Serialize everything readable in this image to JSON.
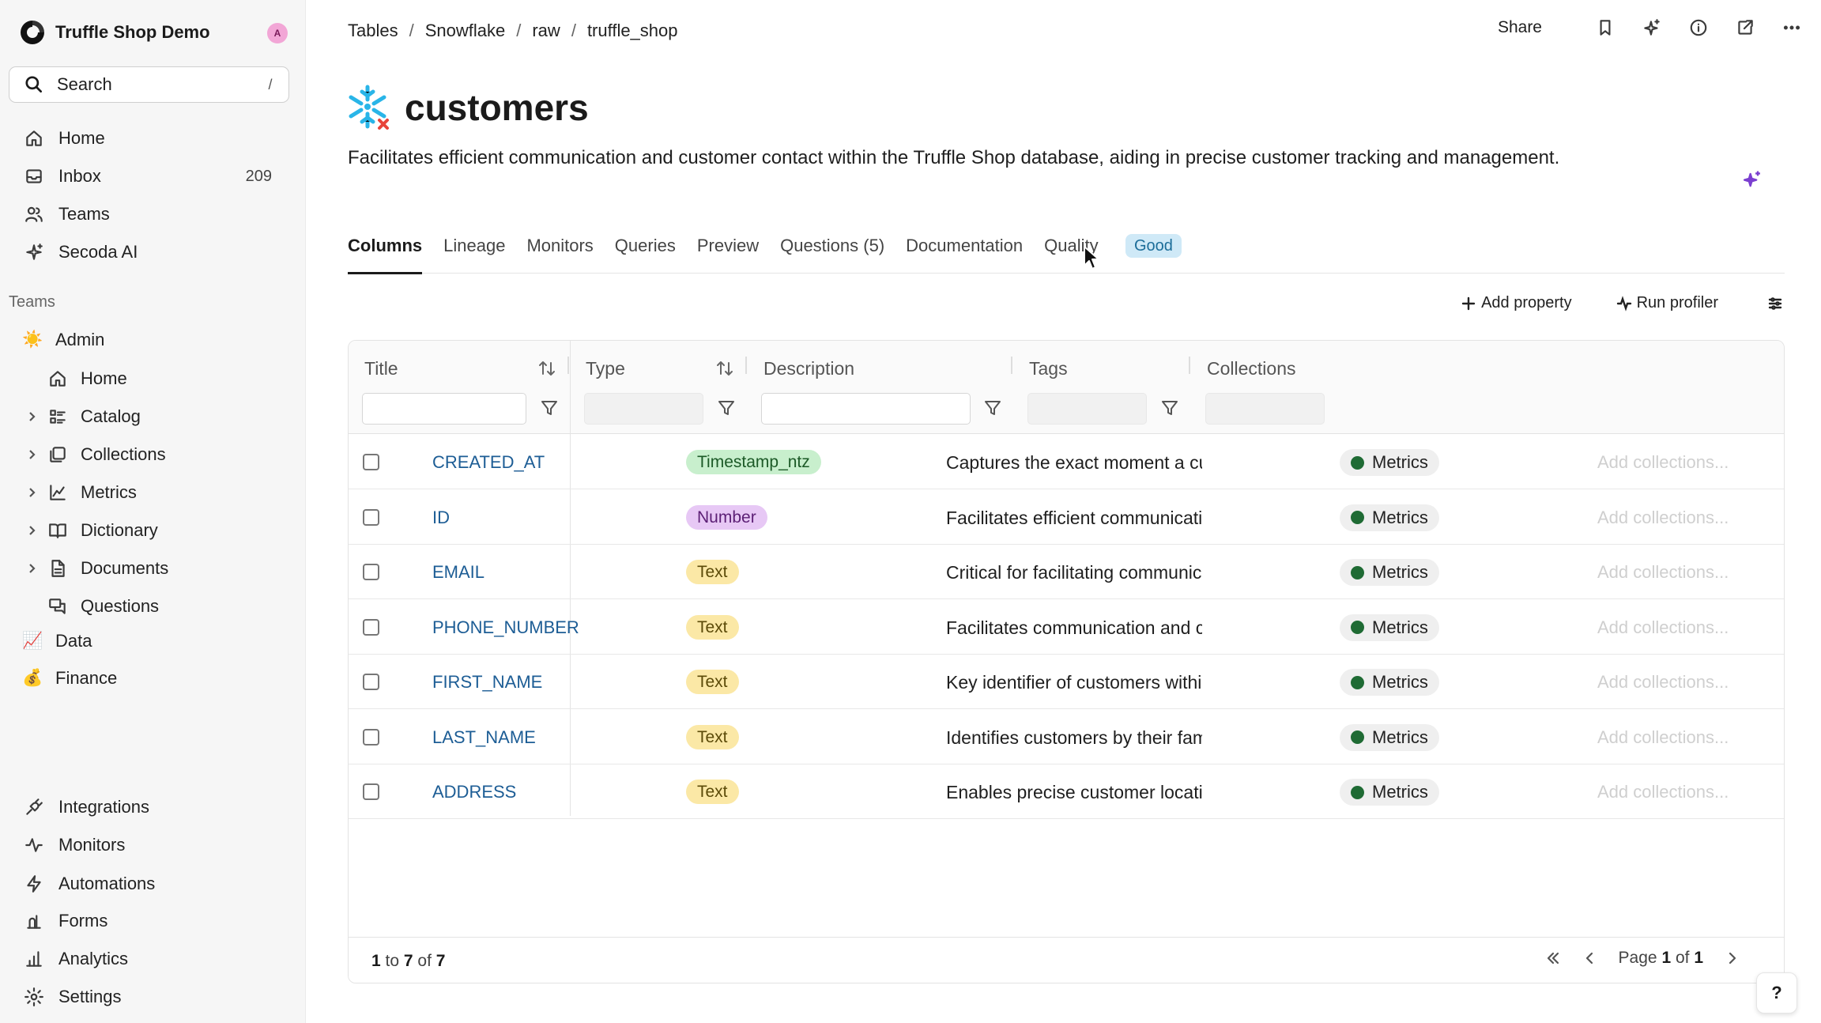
{
  "workspace": {
    "name": "Truffle Shop Demo",
    "avatar": "A"
  },
  "search": {
    "label": "Search",
    "shortcut": "/"
  },
  "nav": [
    {
      "label": "Home",
      "icon": "home-icon"
    },
    {
      "label": "Inbox",
      "icon": "inbox-icon",
      "count": "209"
    },
    {
      "label": "Teams",
      "icon": "users-icon"
    },
    {
      "label": "Secoda AI",
      "icon": "sparkle-icon"
    }
  ],
  "teams_section": {
    "title": "Teams"
  },
  "teams": [
    {
      "emoji": "☀️",
      "label": "Admin"
    },
    {
      "emoji": "📈",
      "label": "Data"
    },
    {
      "emoji": "💰",
      "label": "Finance"
    }
  ],
  "admin_items": [
    {
      "label": "Home",
      "icon": "home-icon",
      "expandable": false
    },
    {
      "label": "Catalog",
      "icon": "catalog-icon",
      "expandable": true
    },
    {
      "label": "Collections",
      "icon": "collections-icon",
      "expandable": true
    },
    {
      "label": "Metrics",
      "icon": "metrics-icon",
      "expandable": true
    },
    {
      "label": "Dictionary",
      "icon": "book-icon",
      "expandable": true
    },
    {
      "label": "Documents",
      "icon": "document-icon",
      "expandable": true
    },
    {
      "label": "Questions",
      "icon": "questions-icon",
      "expandable": false
    }
  ],
  "bottom_nav": [
    {
      "label": "Integrations",
      "icon": "plug-icon"
    },
    {
      "label": "Monitors",
      "icon": "pulse-icon"
    },
    {
      "label": "Automations",
      "icon": "bolt-icon"
    },
    {
      "label": "Forms",
      "icon": "forms-icon"
    },
    {
      "label": "Analytics",
      "icon": "bar-chart-icon"
    },
    {
      "label": "Settings",
      "icon": "gear-icon"
    }
  ],
  "breadcrumb": [
    "Tables",
    "Snowflake",
    "raw",
    "truffle_shop"
  ],
  "header": {
    "share": "Share"
  },
  "page": {
    "title": "customers",
    "description": "Facilitates efficient communication and customer contact within the Truffle Shop database, aiding in precise customer tracking and management."
  },
  "tabs": [
    "Columns",
    "Lineage",
    "Monitors",
    "Queries",
    "Preview",
    "Questions (5)",
    "Documentation",
    "Quality"
  ],
  "quality_badge": "Good",
  "toolbar": {
    "add_property": "Add property",
    "run_profiler": "Run profiler"
  },
  "table": {
    "columns": [
      "Title",
      "Type",
      "Description",
      "Tags",
      "Collections"
    ],
    "rows": [
      {
        "title": "CREATED_AT",
        "type": "Timestamp_ntz",
        "type_kind": "ts",
        "description": "Captures the exact moment a customer record is created",
        "tag": "Metrics",
        "collections": "Add collections..."
      },
      {
        "title": "ID",
        "type": "Number",
        "type_kind": "num",
        "description": "Facilitates efficient communication between customers",
        "tag": "Metrics",
        "collections": "Add collections..."
      },
      {
        "title": "EMAIL",
        "type": "Text",
        "type_kind": "text",
        "description": "Critical for facilitating communication between",
        "tag": "Metrics",
        "collections": "Add collections..."
      },
      {
        "title": "PHONE_NUMBER",
        "type": "Text",
        "type_kind": "text",
        "description": "Facilitates communication and customer contact",
        "tag": "Metrics",
        "collections": "Add collections..."
      },
      {
        "title": "FIRST_NAME",
        "type": "Text",
        "type_kind": "text",
        "description": "Key identifier of customers within the Truffle Shop",
        "tag": "Metrics",
        "collections": "Add collections..."
      },
      {
        "title": "LAST_NAME",
        "type": "Text",
        "type_kind": "text",
        "description": "Identifies customers by their family name to",
        "tag": "Metrics",
        "collections": "Add collections..."
      },
      {
        "title": "ADDRESS",
        "type": "Text",
        "type_kind": "text",
        "description": "Enables precise customer location analysis for",
        "tag": "Metrics",
        "collections": "Add collections..."
      }
    ]
  },
  "footer": {
    "range_start": "1",
    "range_end": "7",
    "total": "7",
    "page": "1",
    "pages": "1"
  },
  "help": "?",
  "colors": {
    "link": "#1d5d95",
    "tag_dot": "#1f6b34",
    "badge_bg": "#cfe9f7",
    "ai_accent": "#7b3fd0"
  }
}
